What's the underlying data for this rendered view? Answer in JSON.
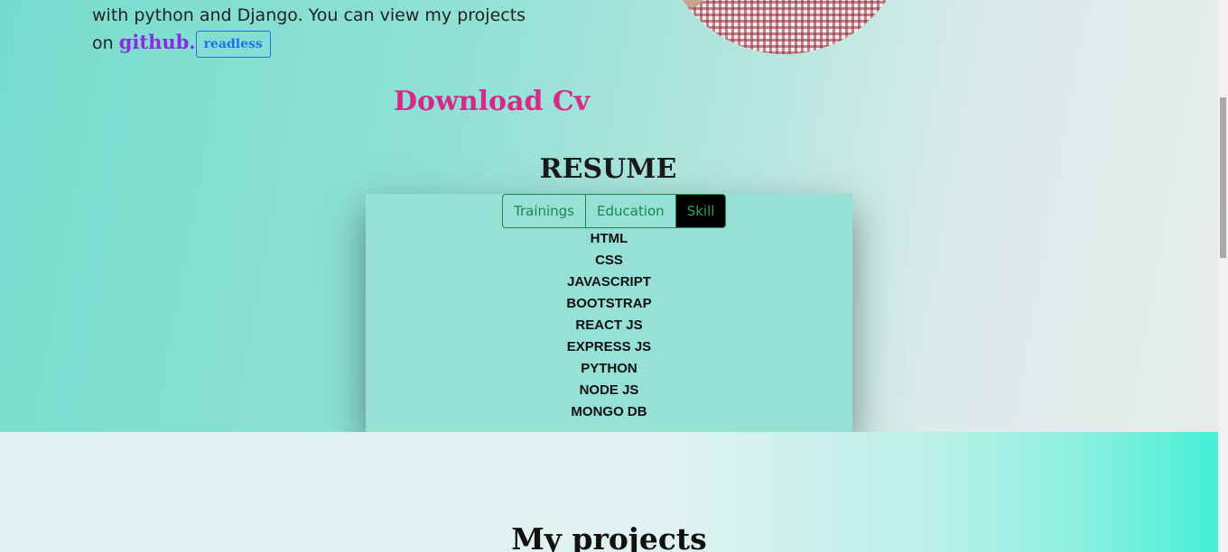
{
  "intro": {
    "line1": "with python and Django. You can view my projects",
    "prefix": "on",
    "github_label": "github.",
    "readless_label": "readless"
  },
  "download_cv": "Download Cv",
  "resume": {
    "title": "RESUME",
    "tabs": [
      "Trainings",
      "Education",
      "Skill"
    ],
    "active_tab": "Skill",
    "skills": [
      "HTML",
      "CSS",
      "JAVASCRIPT",
      "BOOTSTRAP",
      "REACT JS",
      "EXPRESS JS",
      "PYTHON",
      "NODE JS",
      "MONGO DB"
    ]
  },
  "projects": {
    "title": "My projects"
  },
  "colors": {
    "download_cv": "#d6298a",
    "github": "#8a2be2",
    "tab_accent": "#198754",
    "readless": "#1a73e8"
  }
}
